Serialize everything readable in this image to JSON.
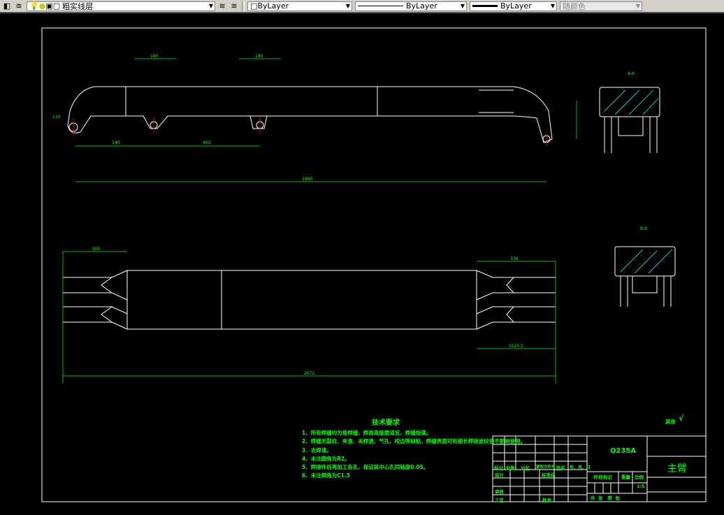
{
  "toolbar": {
    "layer_name": "粗实线层",
    "color": "ByLayer",
    "linetype": "ByLayer",
    "lineweight": "ByLayer",
    "plot_style": "随颜色"
  },
  "drawing": {
    "section_a": "A-A",
    "section_b": "B-B",
    "dims": {
      "d190": "190",
      "d180": "180",
      "d1990": "1990",
      "d540": "540",
      "d462": "462",
      "d500": "500",
      "d336": "336",
      "d2672": "2672",
      "d1020": "1020.5",
      "d110": "110"
    },
    "roughness": "其余",
    "tech_title": "技术要求",
    "tech_items": [
      "1、所有焊缝均为角焊缝，焊角高度要适宜，焊缝饱满。",
      "2、焊缝无裂纹、夹渣、未焊透、气孔、咬边等缺陷，焊缝表面可有细长焊接波纹但不影响使用。",
      "3、去焊渣。",
      "4、未注圆角为R2。",
      "5、焊接件后再加工各孔，保证其中心孔同轴度0.05。",
      "6、未注倒角为C1.5"
    ]
  },
  "title_block": {
    "material": "Q235A",
    "part_name": "主臂",
    "headers": [
      "标记",
      "处数",
      "分区",
      "更改文件号",
      "签名",
      "年、月、日"
    ],
    "design": "设计",
    "standard": "标准化",
    "review": "审核",
    "process": "工艺",
    "approve": "批准",
    "stage": "阶段标记",
    "weight": "重量",
    "scale_label": "比例",
    "scale": "1:5",
    "sheets": "共  张   第  张"
  },
  "colors": {
    "line": "#ffffff",
    "dim": "#00ff00",
    "center": "#ff0000",
    "hatch": "#00ffff"
  }
}
